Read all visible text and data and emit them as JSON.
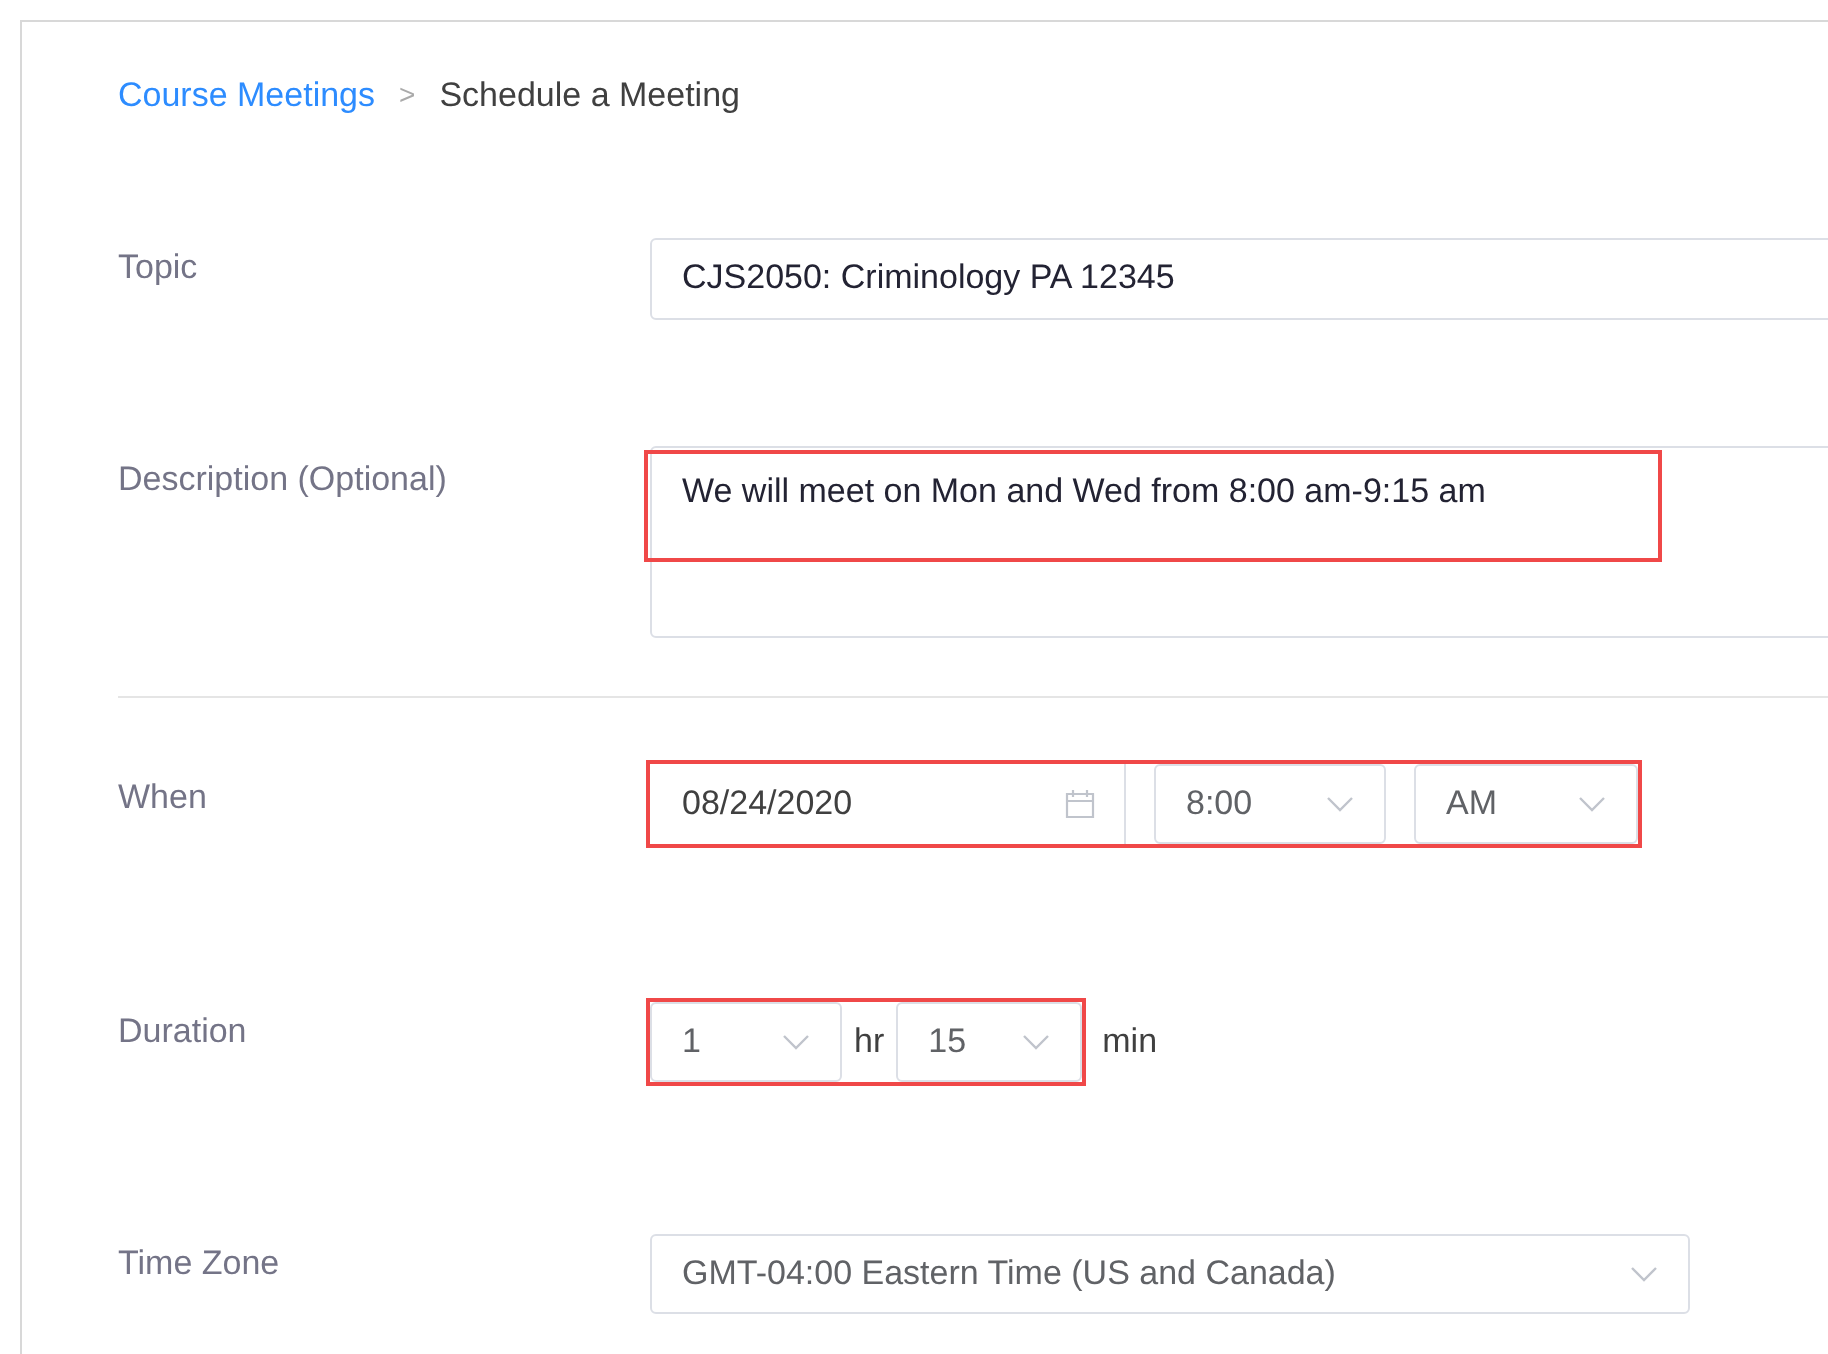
{
  "breadcrumb": {
    "link": "Course Meetings",
    "separator": ">",
    "current": "Schedule a Meeting"
  },
  "topic": {
    "label": "Topic",
    "value": "CJS2050: Criminology PA 12345",
    "highlighted": false
  },
  "description": {
    "label": "Description (Optional)",
    "value": "We will meet on Mon and Wed from 8:00 am-9:15 am",
    "highlighted": true
  },
  "when": {
    "label": "When",
    "date": "08/24/2020",
    "time": "8:00",
    "ampm": "AM",
    "highlighted": true
  },
  "duration": {
    "label": "Duration",
    "hours": "1",
    "hours_unit": "hr",
    "minutes": "15",
    "minutes_unit": "min",
    "highlighted": true
  },
  "time_zone": {
    "label": "Time Zone",
    "value": "GMT-04:00 Eastern Time (US and Canada)",
    "highlighted": false
  }
}
